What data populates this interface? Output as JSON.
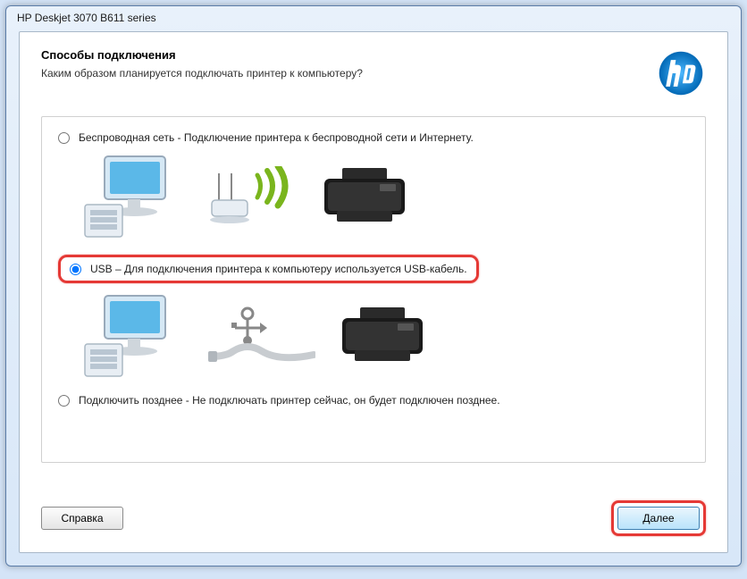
{
  "window": {
    "title": "HP Deskjet 3070 B611 series"
  },
  "header": {
    "heading": "Способы подключения",
    "subtitle": "Каким образом планируется подключать принтер к компьютеру?",
    "logo_name": "hp-logo"
  },
  "options": {
    "wireless": {
      "label": "Беспроводная сеть - Подключение принтера к беспроводной сети и Интернету.",
      "selected": false
    },
    "usb": {
      "label": "USB – Для подключения принтера к компьютеру используется USB-кабель.",
      "selected": true
    },
    "later": {
      "label": "Подключить позднее - Не подключать принтер сейчас, он будет подключен  позднее.",
      "selected": false
    }
  },
  "footer": {
    "help_label": "Справка",
    "next_label": "Далее"
  }
}
